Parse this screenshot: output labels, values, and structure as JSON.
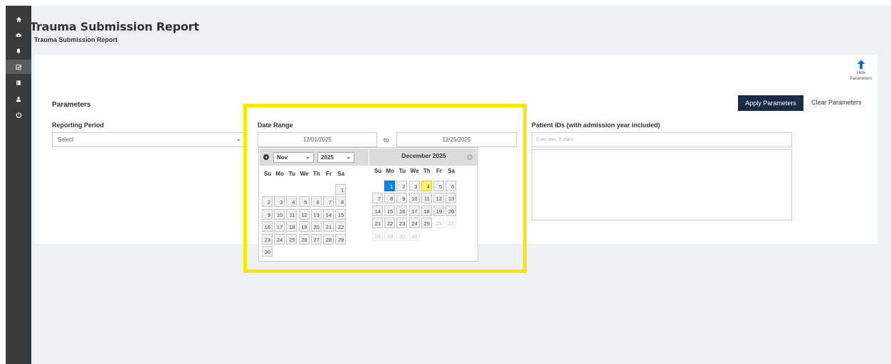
{
  "sidebar": {
    "items": [
      {
        "icon": "home-icon"
      },
      {
        "icon": "cloud-upload-icon"
      },
      {
        "icon": "bell-icon"
      },
      {
        "icon": "checkbox-icon",
        "active": true
      },
      {
        "icon": "document-icon"
      },
      {
        "icon": "user-icon"
      },
      {
        "icon": "power-icon"
      }
    ]
  },
  "page": {
    "title": "Trauma Submission Report",
    "breadcrumb": "Trauma Submission Report"
  },
  "params": {
    "heading": "Parameters",
    "hide_label": "Hide",
    "hide_label2": "Parameters",
    "apply_label": "Apply Parameters",
    "clear_label": "Clear Parameters",
    "reporting_period": {
      "label": "Reporting Period",
      "value": "Select"
    },
    "date_range": {
      "label": "Date Range",
      "from": "12/01/2025",
      "to_label": "to",
      "to": "12/25/2025"
    },
    "patient_ids": {
      "label": "Patient IDs (with admission year included)",
      "placeholder": "Enter min. 3 chars"
    }
  },
  "datepicker": {
    "prev_icon": "prev-icon",
    "next_icon": "next-icon",
    "left": {
      "month": "Nov",
      "year": "2025",
      "weeks": [
        [
          "",
          "",
          "",
          "",
          "",
          "",
          "1"
        ],
        [
          "2",
          "3",
          "4",
          "5",
          "6",
          "7",
          "8"
        ],
        [
          "9",
          "10",
          "11",
          "12",
          "13",
          "14",
          "15"
        ],
        [
          "16",
          "17",
          "18",
          "19",
          "20",
          "21",
          "22"
        ],
        [
          "23",
          "24",
          "25",
          "26",
          "27",
          "28",
          "29"
        ],
        [
          "30",
          "",
          "",
          "",
          "",
          "",
          ""
        ]
      ]
    },
    "right": {
      "title": "December 2025",
      "weeks": [
        [
          "",
          "1",
          "2",
          "3",
          "4",
          "5",
          "6"
        ],
        [
          "7",
          "8",
          "9",
          "10",
          "11",
          "12",
          "13"
        ],
        [
          "14",
          "15",
          "16",
          "17",
          "18",
          "19",
          "20"
        ],
        [
          "21",
          "22",
          "23",
          "24",
          "25",
          "26",
          "27"
        ],
        [
          "28",
          "29",
          "30",
          "31",
          "",
          "",
          ""
        ]
      ],
      "selected": "1",
      "today": "4"
    },
    "weekdays": [
      "Su",
      "Mo",
      "Tu",
      "We",
      "Th",
      "Fr",
      "Sa"
    ]
  },
  "colors": {
    "sidebar": "#3a3a3a",
    "apply": "#1b2a47",
    "selected": "#0f83e6",
    "today": "#fdf07c",
    "highlight": "#ffe600"
  }
}
